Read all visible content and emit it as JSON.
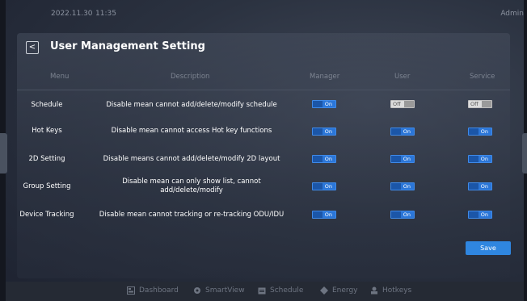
{
  "status_bar": {
    "date": "2022.11.30",
    "time": "11:35",
    "user": "Admin"
  },
  "page": {
    "title": "User Management Setting",
    "back_icon": "chevron-left-icon"
  },
  "table": {
    "headers": {
      "menu": "Menu",
      "description": "Description",
      "manager": "Manager",
      "user": "User",
      "service": "Service"
    },
    "rows": [
      {
        "menu": "Schedule",
        "description": "Disable mean cannot add/delete/modify schedule",
        "manager": "On",
        "user": "Off",
        "service": "Off"
      },
      {
        "menu": "Hot Keys",
        "description": "Disable mean cannot access Hot key functions",
        "manager": "On",
        "user": "On",
        "service": "On"
      },
      {
        "menu": "2D Setting",
        "description": "Disable means cannot add/delete/modify 2D layout",
        "manager": "On",
        "user": "On",
        "service": "On"
      },
      {
        "menu": "Group Setting",
        "description": "Disable mean can only show list, cannot add/delete/modify",
        "manager": "On",
        "user": "On",
        "service": "On"
      },
      {
        "menu": "Device Tracking",
        "description": "Disable mean cannot tracking or re-tracking ODU/IDU",
        "manager": "On",
        "user": "On",
        "service": "On"
      }
    ]
  },
  "actions": {
    "save_label": "Save"
  },
  "nav": {
    "dashboard": "Dashboard",
    "smartview": "SmartView",
    "schedule": "Schedule",
    "energy": "Energy",
    "hotkeys": "Hotkeys"
  },
  "colors": {
    "toggle_on": "#2b76d8",
    "toggle_off": "#dcdcdc",
    "save": "#2f86e0"
  }
}
